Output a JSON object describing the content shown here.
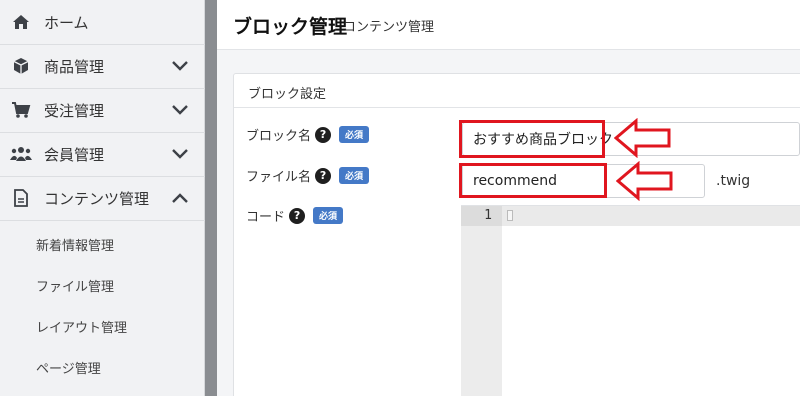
{
  "sidebar": {
    "items": [
      {
        "label": "ホーム",
        "icon": "home-icon",
        "chevron": "none"
      },
      {
        "label": "商品管理",
        "icon": "cube-icon",
        "chevron": "down"
      },
      {
        "label": "受注管理",
        "icon": "cart-icon",
        "chevron": "down"
      },
      {
        "label": "会員管理",
        "icon": "users-icon",
        "chevron": "down"
      },
      {
        "label": "コンテンツ管理",
        "icon": "document-icon",
        "chevron": "up"
      }
    ],
    "subitems": [
      {
        "label": "新着情報管理"
      },
      {
        "label": "ファイル管理"
      },
      {
        "label": "レイアウト管理"
      },
      {
        "label": "ページ管理"
      }
    ]
  },
  "header": {
    "title": "ブロック管理",
    "subtitle": "コンテンツ管理"
  },
  "card": {
    "title": "ブロック設定",
    "fields": {
      "block_name": {
        "label": "ブロック名",
        "help": "?",
        "required": "必須",
        "value": "おすすめ商品ブロック"
      },
      "file_name": {
        "label": "ファイル名",
        "help": "?",
        "required": "必須",
        "value": "recommend",
        "suffix": ".twig"
      },
      "code": {
        "label": "コード",
        "help": "?",
        "required": "必須",
        "line_number": "1"
      }
    }
  },
  "colors": {
    "accent": "#4479c7",
    "annotation": "#e0161f"
  }
}
